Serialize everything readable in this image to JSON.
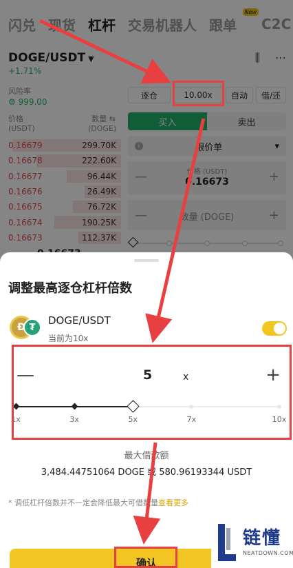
{
  "top_tabs": [
    {
      "label": "闪兑",
      "active": false
    },
    {
      "label": "现货",
      "active": false
    },
    {
      "label": "杠杆",
      "active": true
    },
    {
      "label": "交易机器人",
      "active": false
    },
    {
      "label": "跟单",
      "active": false,
      "badge": "New"
    },
    {
      "label": "C2C",
      "active": false
    }
  ],
  "market": {
    "pair": "DOGE/USDT",
    "change": "+1.71%",
    "risk_label": "风险率",
    "risk_value": "999.00"
  },
  "orderbook": {
    "price_header": "价格\n(USDT)",
    "qty_header": "数量 ⇆\n(DOGE)",
    "rows": [
      {
        "price": "0.16679",
        "qty": "299.70K",
        "depth": 0.9
      },
      {
        "price": "0.16678",
        "qty": "222.60K",
        "depth": 0.7
      },
      {
        "price": "0.16677",
        "qty": "96.44K",
        "depth": 0.45
      },
      {
        "price": "0.16676",
        "qty": "26.49K",
        "depth": 0.3
      },
      {
        "price": "0.16675",
        "qty": "76.72K",
        "depth": 0.4
      },
      {
        "price": "0.16674",
        "qty": "190.25K",
        "depth": 0.55
      },
      {
        "price": "0.16673",
        "qty": "112.37K",
        "depth": 0.35
      }
    ],
    "last_price_peek": "0.16673"
  },
  "trade_panel": {
    "margin_mode": "逐仓",
    "leverage": "10.00x",
    "auto": "自动",
    "borrow": "借/还",
    "buy": "买入",
    "sell": "卖出",
    "order_type": "限价单",
    "price_label": "价格 (USDT)",
    "price_value": "0.16673",
    "amount_placeholder": "数量 (DOGE)"
  },
  "sheet": {
    "title": "调整最高逐仓杠杆倍数",
    "pair": "DOGE/USDT",
    "current": "当前为10x",
    "toggle_on": true,
    "leverage_value": "5",
    "leverage_unit": "x",
    "slider": {
      "min": 1,
      "max": 10,
      "value": 5,
      "labels": [
        "1x",
        "3x",
        "5x",
        "7x",
        "10x"
      ]
    },
    "max_borrow_label": "最大借款额",
    "max_borrow_value": "3,484.44751064 DOGE 或 580.96193344 USDT",
    "note": "* 调低杠杆倍数并不一定会降低最大可借数量",
    "note_link": "查看更多",
    "confirm": "确认"
  },
  "watermark": {
    "cn": "链懂",
    "en": "NEATDOWN.COM"
  },
  "colors": {
    "accent": "#f3c522",
    "buy": "#20b26c",
    "sell": "#e0484f",
    "annotation": "#e84040"
  }
}
